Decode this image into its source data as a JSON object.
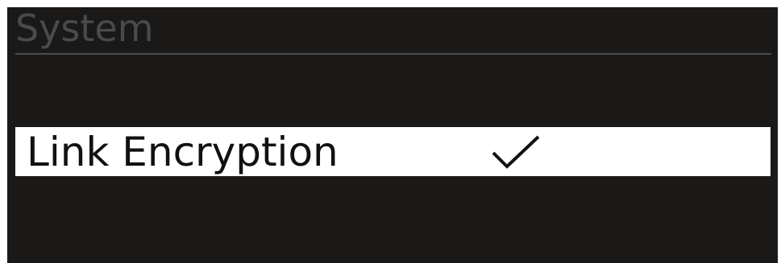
{
  "header": {
    "title": "System"
  },
  "menu": {
    "items": [
      {
        "label": "Link Encryption",
        "selected": true,
        "checked": true,
        "icon": "checkmark-icon"
      }
    ]
  },
  "colors": {
    "background": "#1a1918",
    "header_text": "#4a4a4a",
    "selected_bg": "#ffffff",
    "selected_text": "#111111"
  }
}
